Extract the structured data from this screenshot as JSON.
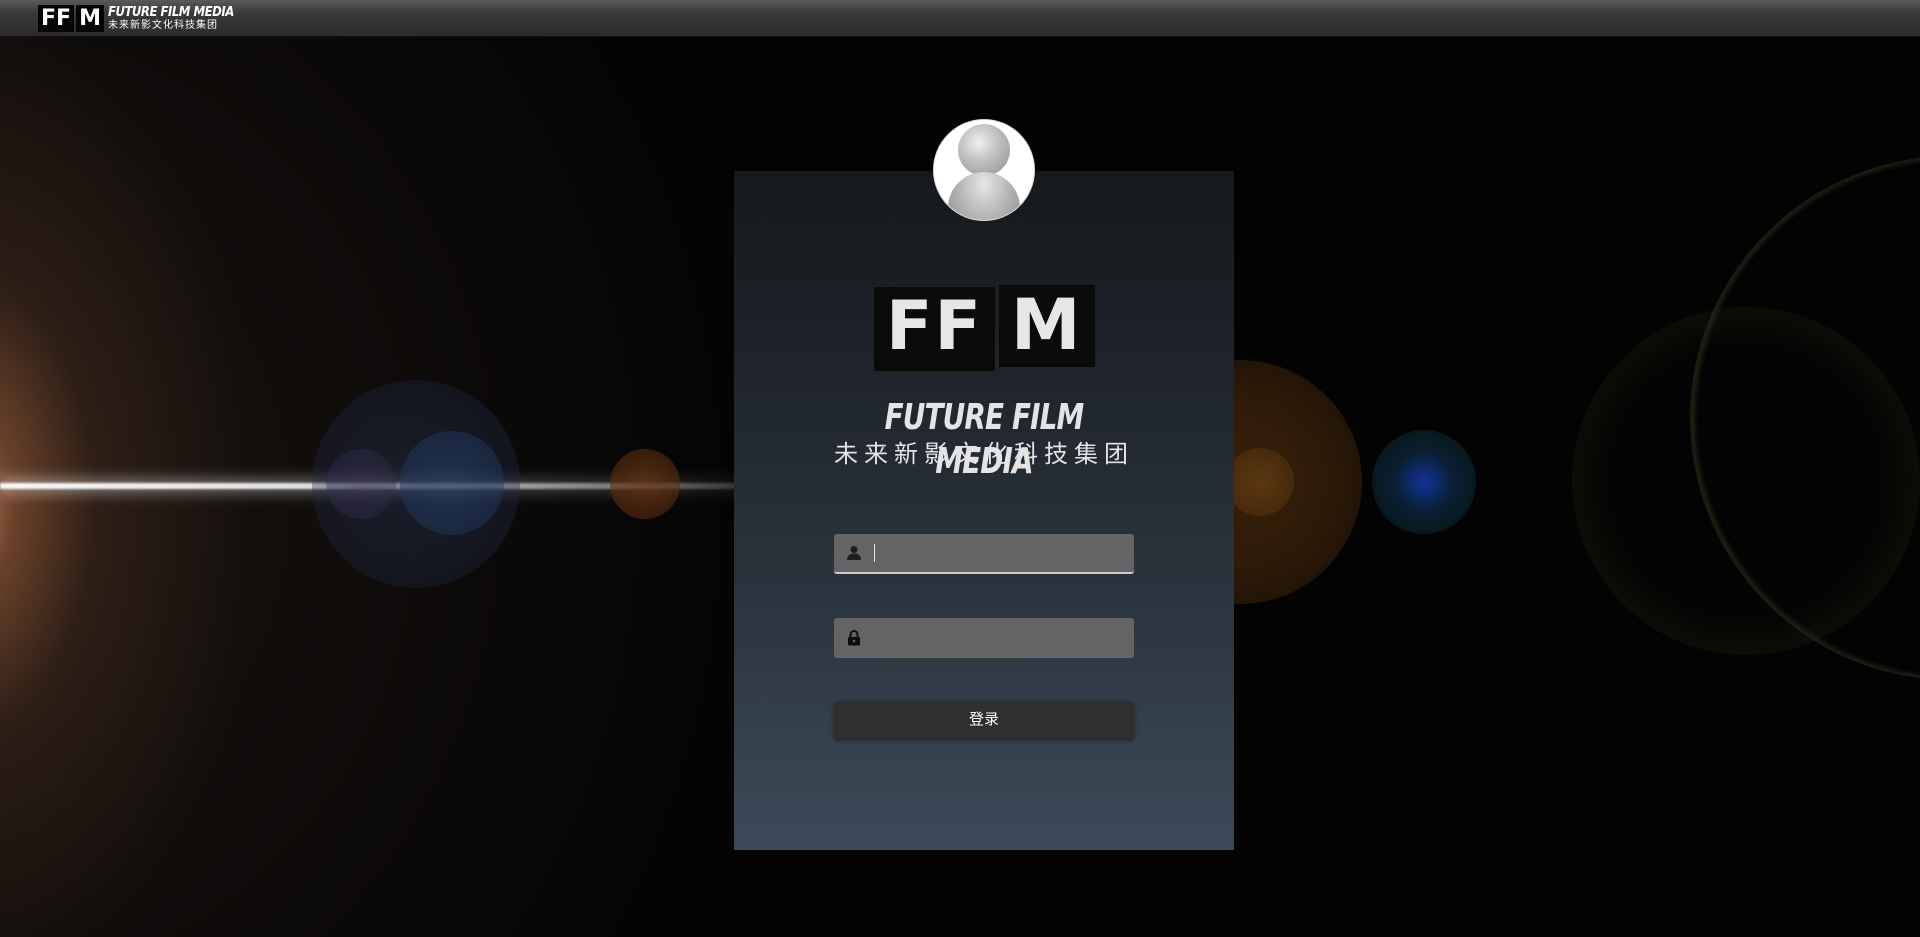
{
  "topbar": {
    "logo_mark_1": "FF",
    "logo_mark_2": "M",
    "logo_en": "FUTURE FILM MEDIA",
    "logo_cn": "未来新影文化科技集团"
  },
  "login": {
    "brand_mark_1": "FF",
    "brand_mark_2": "M",
    "brand_en": "FUTURE FILM MEDIA",
    "brand_cn": "未来新影文化科技集团",
    "username": {
      "value": "",
      "placeholder": "",
      "icon": "user-icon"
    },
    "password": {
      "value": "",
      "placeholder": "",
      "icon": "lock-icon"
    },
    "submit_label": "登录",
    "avatar_icon": "default-user-avatar"
  },
  "colors": {
    "topbar": "#3a3a3a",
    "panel_top": "#15191d",
    "panel_bottom": "#3b4a59",
    "field_bg": "#646464",
    "button_bg": "#2f2f2f"
  }
}
